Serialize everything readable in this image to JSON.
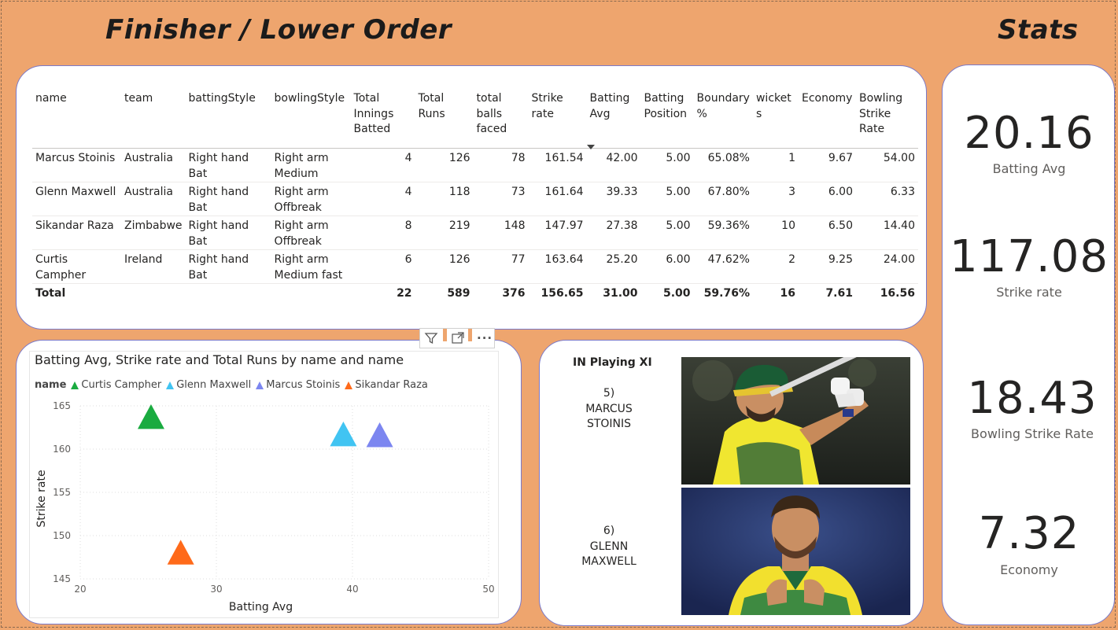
{
  "page": {
    "title_left": "Finisher / Lower Order",
    "title_right": "Stats"
  },
  "table": {
    "headers": [
      "name",
      "team",
      "battingStyle",
      "bowlingStyle",
      "Total\nInnings\nBatted",
      "Total\nRuns",
      "total\nballs\nfaced",
      "Strike\nrate",
      "Batting\nAvg",
      "Batting\nPosition",
      "Boundary\n%",
      "wicket\ns",
      "Economy",
      "Bowling\nStrike Rate"
    ],
    "rows": [
      [
        "Marcus Stoinis",
        "Australia",
        "Right hand Bat",
        "Right arm\nMedium",
        "4",
        "126",
        "78",
        "161.54",
        "42.00",
        "5.00",
        "65.08%",
        "1",
        "9.67",
        "54.00"
      ],
      [
        "Glenn Maxwell",
        "Australia",
        "Right hand Bat",
        "Right arm\nOffbreak",
        "4",
        "118",
        "73",
        "161.64",
        "39.33",
        "5.00",
        "67.80%",
        "3",
        "6.00",
        "6.33"
      ],
      [
        "Sikandar Raza",
        "Zimbabwe",
        "Right hand Bat",
        "Right arm\nOffbreak",
        "8",
        "219",
        "148",
        "147.97",
        "27.38",
        "5.00",
        "59.36%",
        "10",
        "6.50",
        "14.40"
      ],
      [
        "Curtis Campher",
        "Ireland",
        "Right hand Bat",
        "Right arm\nMedium fast",
        "6",
        "126",
        "77",
        "163.64",
        "25.20",
        "6.00",
        "47.62%",
        "2",
        "9.25",
        "24.00"
      ]
    ],
    "total": [
      "Total",
      "",
      "",
      "",
      "22",
      "589",
      "376",
      "156.65",
      "31.00",
      "5.00",
      "59.76%",
      "16",
      "7.61",
      "16.56"
    ]
  },
  "stats": [
    {
      "value": "20.16",
      "label": "Batting Avg"
    },
    {
      "value": "117.08",
      "label": "Strike rate"
    },
    {
      "value": "18.43",
      "label": "Bowling Strike Rate"
    },
    {
      "value": "7.32",
      "label": "Economy"
    }
  ],
  "chart_toolbar": {
    "filter_icon": "filter-icon",
    "focus_icon": "focus-mode-icon",
    "more_icon": "more-options-icon",
    "more_label": "..."
  },
  "chart_data": {
    "type": "scatter",
    "title": "Batting Avg, Strike rate and Total Runs by name and name",
    "legend_title": "name",
    "legend_position": "top-left",
    "xlabel": "Batting Avg",
    "ylabel": "Strike rate",
    "xlim": [
      20,
      50
    ],
    "ylim": [
      145,
      165
    ],
    "xticks": [
      "20",
      "30",
      "40",
      "50"
    ],
    "yticks": [
      "145",
      "150",
      "155",
      "160",
      "165"
    ],
    "grid": true,
    "marker": "triangle",
    "series": [
      {
        "name": "Curtis Campher",
        "color": "#1AAB40",
        "x": 25.2,
        "y": 163.64
      },
      {
        "name": "Glenn Maxwell",
        "color": "#41C4F2",
        "x": 39.33,
        "y": 161.64
      },
      {
        "name": "Marcus Stoinis",
        "color": "#7C86F0",
        "x": 42.0,
        "y": 161.54
      },
      {
        "name": "Sikandar Raza",
        "color": "#FF6A1A",
        "x": 27.38,
        "y": 147.97
      }
    ]
  },
  "playing_xi": {
    "title": "IN Playing XI",
    "players": [
      {
        "text": "5)\nMARCUS\nSTOINIS",
        "photo_icon": "player-photo-marcus-stoinis"
      },
      {
        "text": "6)\nGLENN\nMAXWELL",
        "photo_icon": "player-photo-glenn-maxwell"
      }
    ]
  },
  "colors": {
    "background": "#EEA56E",
    "panel": "#FFFFFF",
    "panel_border": "#7A79C9"
  }
}
